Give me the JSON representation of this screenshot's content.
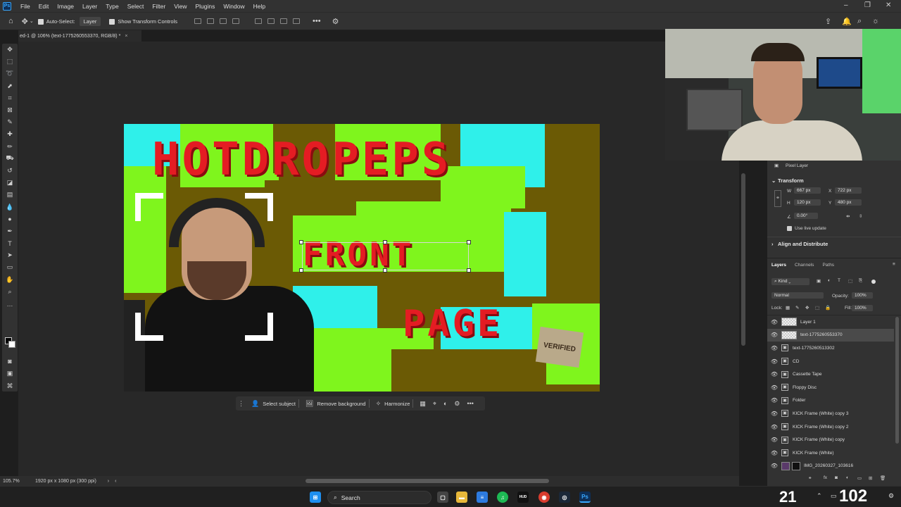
{
  "menubar": {
    "logo": "Ps",
    "items": [
      "File",
      "Edit",
      "Image",
      "Layer",
      "Type",
      "Select",
      "Filter",
      "View",
      "Plugins",
      "Window",
      "Help"
    ]
  },
  "options": {
    "auto_select_label": "Auto-Select:",
    "auto_select_value": "Layer",
    "transform_controls_label": "Show Transform Controls"
  },
  "document": {
    "tab_title": "ed-1 @ 106% (text-1775260553370, RGB/8) *",
    "close": "×"
  },
  "canvas": {
    "title_line": "HOTDROPEPS",
    "middle_line": "FRONT",
    "bottom_line": "PAGE",
    "verified_label": "VERIFIED",
    "colors": {
      "green": "#7ff51d",
      "cyan": "#2ff0ea",
      "olive": "#6b5a05",
      "red": "#e41c23"
    }
  },
  "context_bar": {
    "select_subject": "Select subject",
    "remove_background": "Remove background",
    "harmonize": "Harmonize"
  },
  "status": {
    "zoom": "105.7%",
    "doc_info": "1920 px x 1080 px (300 ppi)"
  },
  "properties": {
    "kind_label": "Pixel Layer",
    "transform_title": "Transform",
    "w": "667 px",
    "h": "120 px",
    "x": "722 px",
    "y": "480 px",
    "angle": "0.00°",
    "live_update": "Use live update",
    "align_title": "Align and Distribute"
  },
  "layers_panel": {
    "tabs": [
      "Layers",
      "Channels",
      "Paths"
    ],
    "kind": "Kind",
    "blend_mode": "Normal",
    "opacity_label": "Opacity:",
    "opacity_value": "100%",
    "lock_label": "Lock:",
    "fill_label": "Fill:",
    "fill_value": "100%",
    "layers": [
      {
        "name": "Layer 1",
        "selected": false
      },
      {
        "name": "text-1775260553370",
        "selected": true
      },
      {
        "name": "text-1775260513302",
        "selected": false
      },
      {
        "name": "CD",
        "selected": false
      },
      {
        "name": "Cassette Tape",
        "selected": false
      },
      {
        "name": "Floppy Disc",
        "selected": false
      },
      {
        "name": "Folder",
        "selected": false
      },
      {
        "name": "KICK Frame (White) copy 3",
        "selected": false
      },
      {
        "name": "KICK Frame (White) copy 2",
        "selected": false
      },
      {
        "name": "KICK Frame (White) copy",
        "selected": false
      },
      {
        "name": "KICK Frame (White)",
        "selected": false
      },
      {
        "name": "IMG_20260327_103616",
        "selected": false
      }
    ]
  },
  "taskbar": {
    "search_label": "Search",
    "overlay_a": "21",
    "overlay_b": "102"
  }
}
